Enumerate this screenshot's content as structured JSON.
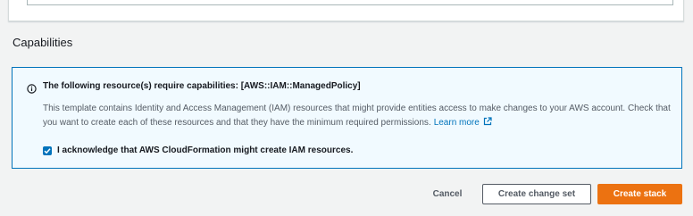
{
  "capabilities": {
    "title": "Capabilities",
    "alert": {
      "title": "The following resource(s) require capabilities: [AWS::IAM::ManagedPolicy]",
      "body": "This template contains Identity and Access Management (IAM) resources that might provide entities access to make changes to your AWS account. Check that you want to create each of these resources and that they have the minimum required permissions.",
      "learn_more": "Learn more",
      "acknowledge_label": "I acknowledge that AWS CloudFormation might create IAM resources.",
      "acknowledge_checked": true
    }
  },
  "actions": {
    "cancel": "Cancel",
    "create_change_set": "Create change set",
    "create_stack": "Create stack"
  },
  "colors": {
    "accent_blue": "#0073bb",
    "primary_orange": "#ec7211",
    "page_bg": "#f2f3f3",
    "alert_bg": "#f1faff"
  }
}
